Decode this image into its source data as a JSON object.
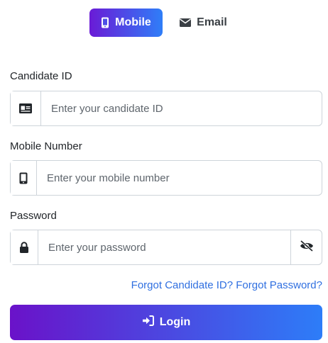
{
  "tabs": {
    "mobile": {
      "label": "Mobile",
      "icon": "mobile-phone-icon",
      "active": true
    },
    "email": {
      "label": "Email",
      "icon": "envelope-icon",
      "active": false
    }
  },
  "form": {
    "candidate_id": {
      "label": "Candidate ID",
      "placeholder": "Enter your candidate ID",
      "icon": "id-card-icon"
    },
    "mobile_number": {
      "label": "Mobile Number",
      "placeholder": "Enter your mobile number",
      "icon": "mobile-phone-icon"
    },
    "password": {
      "label": "Password",
      "placeholder": "Enter your password",
      "icon": "lock-icon",
      "toggle_icon": "eye-slash-icon"
    }
  },
  "links": {
    "forgot_candidate_id": "Forgot Candidate ID?",
    "forgot_password": "Forgot Password?"
  },
  "login": {
    "label": "Login",
    "icon": "sign-in-icon"
  },
  "colors": {
    "gradient_start": "#6a12c9",
    "gradient_end": "#2d7df8",
    "link": "#2f6fe0",
    "border": "#ced4da"
  }
}
